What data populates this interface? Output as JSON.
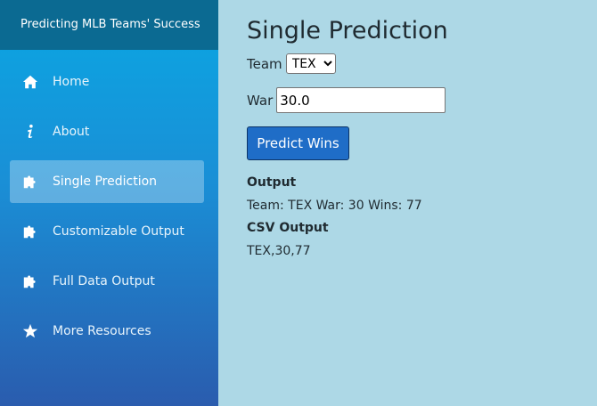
{
  "sidebar": {
    "title": "Predicting MLB Teams' Success",
    "items": [
      {
        "label": "Home",
        "icon": "home-icon"
      },
      {
        "label": "About",
        "icon": "info-icon"
      },
      {
        "label": "Single Prediction",
        "icon": "puzzle-icon",
        "active": true
      },
      {
        "label": "Customizable Output",
        "icon": "puzzle-icon"
      },
      {
        "label": "Full Data Output",
        "icon": "puzzle-icon"
      },
      {
        "label": "More Resources",
        "icon": "star-icon"
      }
    ]
  },
  "main": {
    "title": "Single Prediction",
    "team_label": "Team",
    "team_value": "TEX",
    "war_label": "War",
    "war_value": "30.0",
    "predict_button": "Predict Wins",
    "output_heading": "Output",
    "output_text": "Team: TEX War: 30 Wins: 77",
    "csv_heading": "CSV Output",
    "csv_text": "TEX,30,77"
  },
  "colors": {
    "sidebar_header": "#0b6a92",
    "main_background": "#add8e6",
    "button": "#1f6dc7"
  }
}
